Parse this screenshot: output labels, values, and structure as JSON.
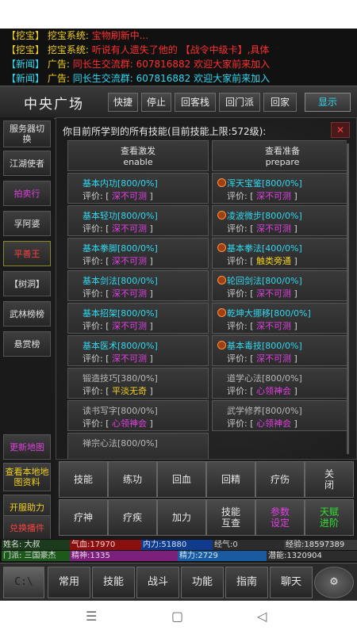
{
  "chat": [
    {
      "tag": "【挖宝】",
      "pre": "挖宝系统:",
      "msg": "宝物刷新中...",
      "tail": ""
    },
    {
      "tag": "【挖宝】",
      "pre": "挖宝系统:",
      "msg": "听说有人遗失了他的",
      "tail": "【战令中级卡】,具体"
    },
    {
      "tag": "【新闻】",
      "pre": "广告:",
      "msg": "同长生交流群: 607816882 欢迎大家前来加入",
      "tail": ""
    },
    {
      "tag": "【新闻】",
      "pre": "广告:",
      "msg": "同长生交流群: 607816882 欢迎大家前来加入",
      "tail": ""
    }
  ],
  "header": {
    "title": "中央广场",
    "buttons": [
      "快捷",
      "停止",
      "回客栈",
      "回门派",
      "回家"
    ],
    "show": "显示"
  },
  "sidebar": [
    "服务器切\n换",
    "江湖使者",
    "拍卖行",
    "孚阿婆",
    "平善王",
    "【树洞】",
    "武林榜榜",
    "悬赏榜"
  ],
  "sidebar_bottom": [
    "更新地图",
    "查看本地地\n图资料",
    "开服助力",
    "兑换播件"
  ],
  "panel": {
    "title": "你目前所学到的所有技能(目前技能上限:572级):",
    "close": "✕",
    "top_left": {
      "label": "查看激发",
      "sub": "enable"
    },
    "top_right": {
      "label": "查看准备",
      "sub": "prepare"
    },
    "eval_label": "评价:",
    "skills": [
      {
        "name": "基本内功[800/0%]",
        "rating": "深不可测",
        "icon": false
      },
      {
        "name": "浑天宝鉴[800/0%]",
        "rating": "深不可测",
        "icon": true
      },
      {
        "name": "基本轻功[800/0%]",
        "rating": "深不可测",
        "icon": false
      },
      {
        "name": "凌波微步[800/0%]",
        "rating": "深不可测",
        "icon": true
      },
      {
        "name": "基本拳脚[800/0%]",
        "rating": "深不可测",
        "icon": false
      },
      {
        "name": "基本拳法[400/0%]",
        "rating": "触类旁通",
        "icon": true
      },
      {
        "name": "基本剑法[800/0%]",
        "rating": "深不可测",
        "icon": false
      },
      {
        "name": "轮回剑法[800/0%]",
        "rating": "深不可测",
        "icon": true
      },
      {
        "name": "基本招架[800/0%]",
        "rating": "深不可测",
        "icon": false
      },
      {
        "name": "乾坤大挪移[800/0%]",
        "rating": "深不可测",
        "icon": true
      },
      {
        "name": "基本医术[800/0%]",
        "rating": "深不可测",
        "icon": false
      },
      {
        "name": "基本毒技[800/0%]",
        "rating": "深不可测",
        "icon": true
      },
      {
        "name": "锻造技巧[380/0%]",
        "rating": "平淡无奇",
        "icon": false
      },
      {
        "name": "道学心法[800/0%]",
        "rating": "心领神会",
        "icon": false
      },
      {
        "name": "读书写字[800/0%]",
        "rating": "心领神会",
        "icon": false
      },
      {
        "name": "武学修养[800/0%]",
        "rating": "心领神会",
        "icon": false
      },
      {
        "name": "禅宗心法[800/0%]",
        "rating": "",
        "icon": false
      }
    ]
  },
  "actions": [
    [
      "技能",
      "练功",
      "回血",
      "回精",
      "疗伤",
      "关\n闭"
    ],
    [
      "疗神",
      "疗疾",
      "加力",
      "技能\n互查",
      "参数\n设定",
      "天赋\n进阶"
    ]
  ],
  "stats": {
    "row1": [
      "姓名: 大叔",
      "气血:17970",
      "内力:51880",
      "经气:0",
      "经验:18597389"
    ],
    "row2": [
      "门派: 三国豪杰",
      "精神:1335",
      "精力:2729",
      "潜能:1320904"
    ]
  },
  "bottom": [
    "常用",
    "技能",
    "战斗",
    "功能",
    "指南",
    "聊天"
  ],
  "colors": {
    "cyan": "#30d8f0",
    "magenta": "#e040e0",
    "yellow": "#f0d020",
    "red": "#ff3030"
  }
}
